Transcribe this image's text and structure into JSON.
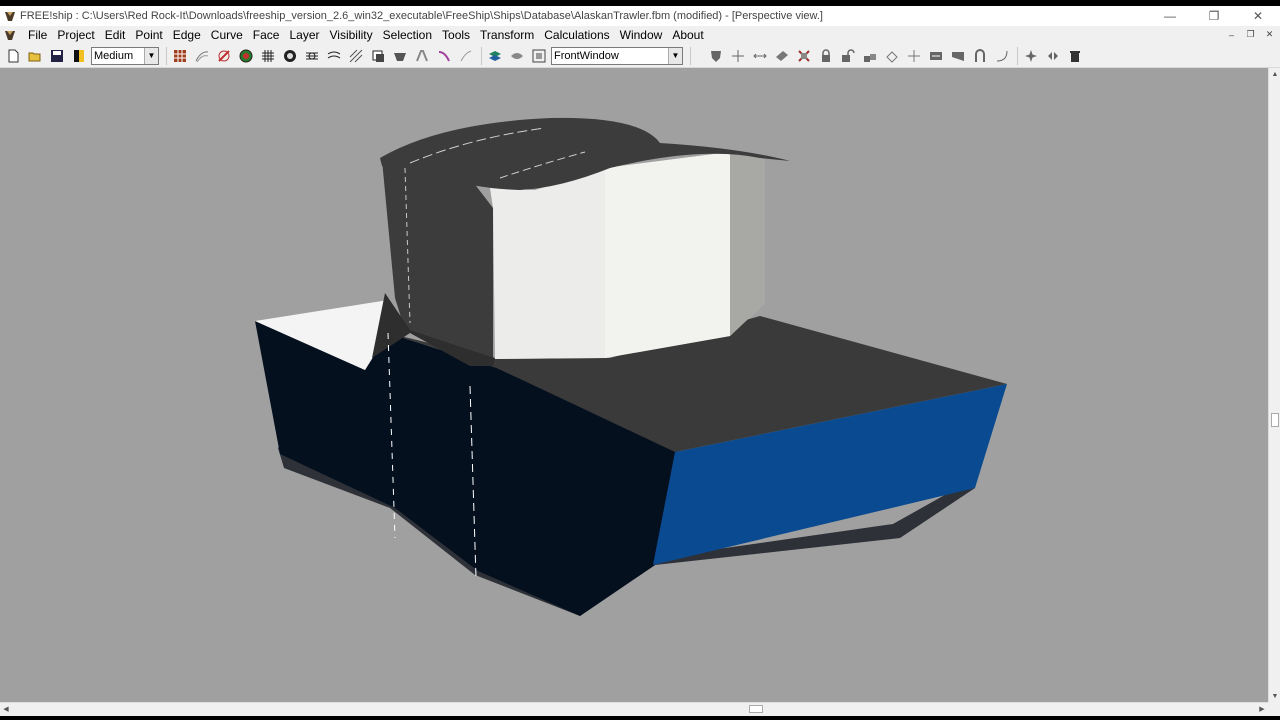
{
  "window": {
    "title": "FREE!ship   : C:\\Users\\Red Rock-It\\Downloads\\freeship_version_2.6_win32_executable\\FreeShip\\Ships\\Database\\AlaskanTrawler.fbm (modified) - [Perspective view.]",
    "minimize_glyph": "—",
    "restore_glyph": "❐",
    "close_glyph": "✕"
  },
  "menu": {
    "items": [
      "File",
      "Project",
      "Edit",
      "Point",
      "Edge",
      "Curve",
      "Face",
      "Layer",
      "Visibility",
      "Selection",
      "Tools",
      "Transform",
      "Calculations",
      "Window",
      "About"
    ],
    "mdi_minimize": "–",
    "mdi_restore": "❐",
    "mdi_close": "✕"
  },
  "toolbar": {
    "precision_value": "Medium",
    "viewport_value": "FrontWindow",
    "combo_arrow": "▼"
  },
  "scrollbars": {
    "up_arrow": "▲",
    "down_arrow": "▼",
    "left_arrow": "◀",
    "right_arrow": "▶"
  },
  "colors": {
    "viewport_bg": "#a0a0a0",
    "hull_dark": "#06101e",
    "hull_transom": "#0a4a90",
    "deck": "#3a3a3a",
    "cabin_light": "#eeeeea",
    "cabin_dark": "#3c3c3c"
  }
}
